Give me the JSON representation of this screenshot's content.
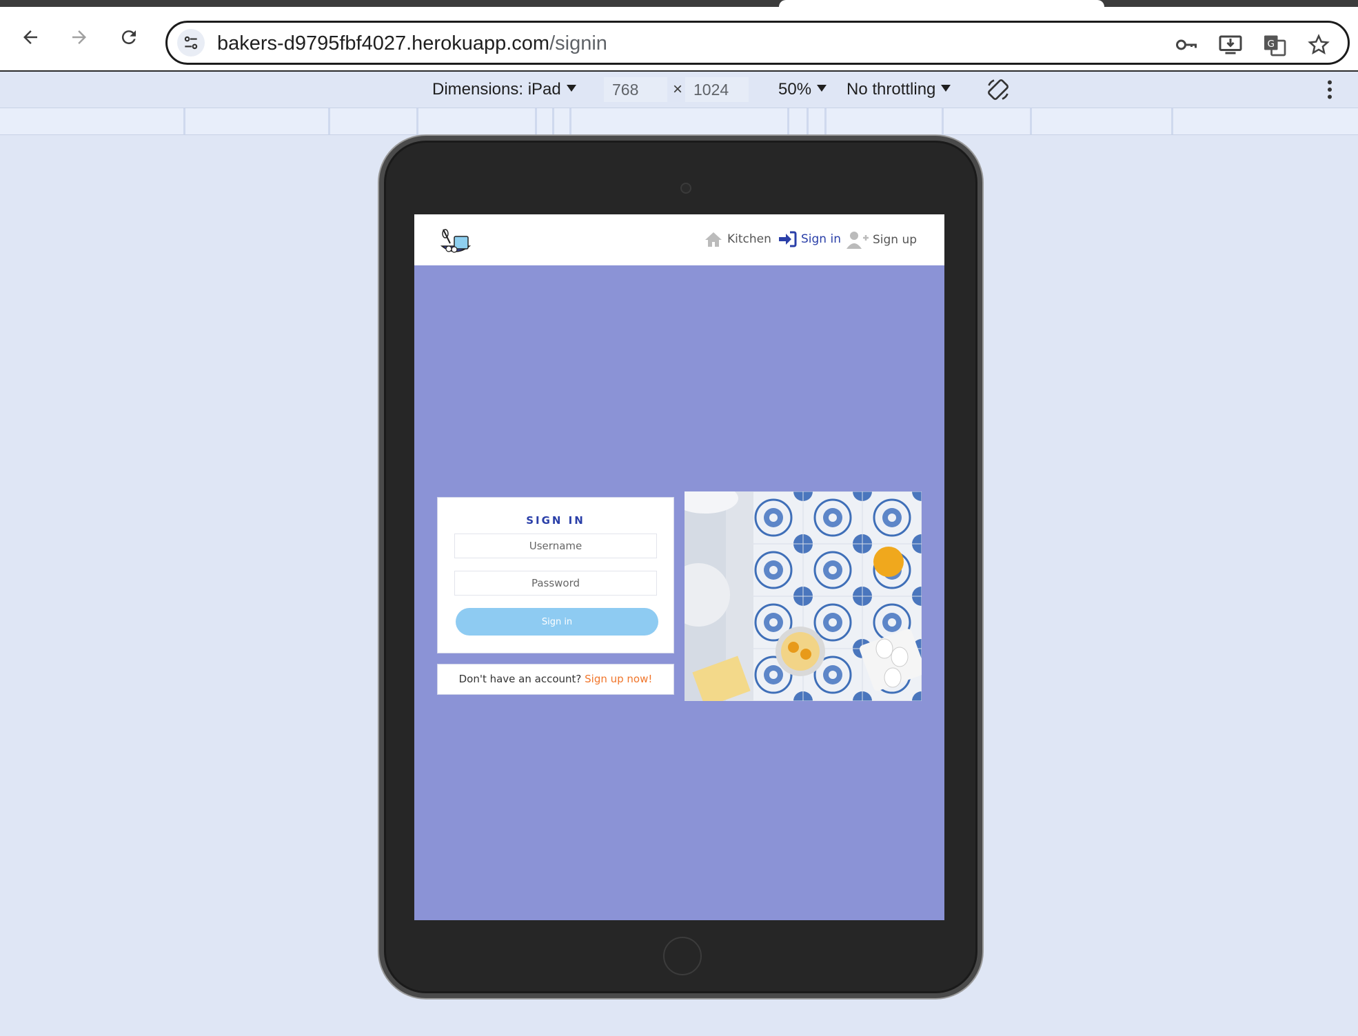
{
  "browser": {
    "url_host": "bakers-d9795fbf4027.herokuapp.com",
    "url_path": "/signin",
    "icons": [
      "back-icon",
      "forward-icon",
      "reload-icon",
      "site-info-icon",
      "key-icon",
      "install-icon",
      "translate-icon",
      "star-icon"
    ]
  },
  "devtools": {
    "dimensions_label": "Dimensions: iPad",
    "width": "768",
    "height": "1024",
    "times": "×",
    "zoom": "50%",
    "throttling": "No throttling"
  },
  "app": {
    "nav": {
      "kitchen": "Kitchen",
      "signin": "Sign in",
      "signup": "Sign up"
    },
    "signin_form": {
      "title": "SIGN IN",
      "username_placeholder": "Username",
      "password_placeholder": "Password",
      "submit_label": "Sign in"
    },
    "signup_prompt": {
      "text": "Don't have an account? ",
      "link": "Sign up now!"
    },
    "colors": {
      "background": "#8b93d6",
      "accent": "#2a3fa8",
      "button": "#8ecbf2",
      "link": "#f0752a"
    }
  }
}
